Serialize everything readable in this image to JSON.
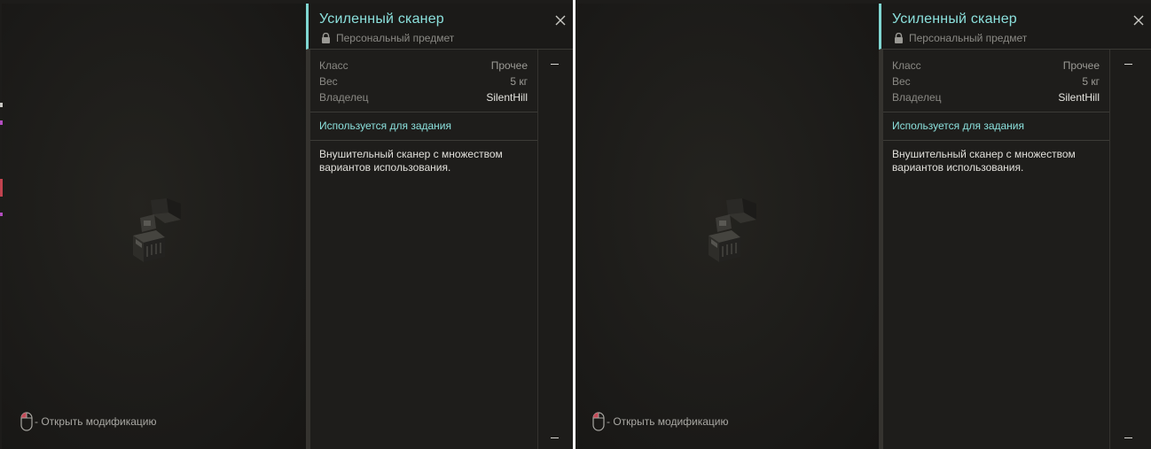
{
  "panes": [
    {
      "item": {
        "title": "Усиленный  сканер",
        "subtitle": "Персональный предмет",
        "properties": [
          {
            "key": "Класс",
            "value": "Прочее"
          },
          {
            "key": "Вес",
            "value": "5 кг"
          },
          {
            "key": "Владелец",
            "value": "SilentHill"
          }
        ],
        "quest_label": "Используется для задания",
        "description": "Внушительный сканер с множеством вариантов использования."
      },
      "hint": "- Открыть модификацию"
    },
    {
      "item": {
        "title": "Усиленный сканер",
        "subtitle": "Персональный предмет",
        "properties": [
          {
            "key": "Класс",
            "value": "Прочее"
          },
          {
            "key": "Вес",
            "value": "5 кг"
          },
          {
            "key": "Владелец",
            "value": "SilentHill"
          }
        ],
        "quest_label": "Используется для задания",
        "description": "Внушительный сканер с множеством вариантов использования."
      },
      "hint": "- Открыть модификацию"
    }
  ],
  "icons": {
    "close": "close-icon",
    "lock": "lock-icon",
    "mouse": "mouse-left-click-icon",
    "item": "scanner-item-icon"
  },
  "colors": {
    "accent": "#8be0dc",
    "background": "#1e1d1b",
    "text": "#e0dfda",
    "muted": "#8a8984"
  }
}
